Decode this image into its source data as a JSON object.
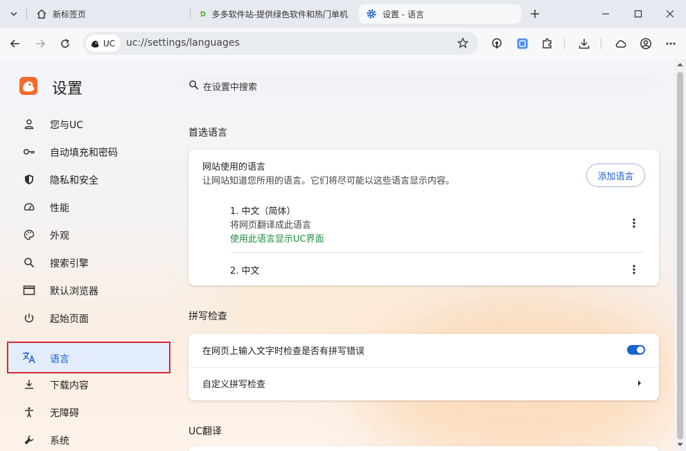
{
  "tabs": [
    {
      "label": "新标签页"
    },
    {
      "label": "多多软件站-提供绿色软件和热门单机"
    },
    {
      "label": "设置 - 语言"
    }
  ],
  "omnibox": {
    "chip_label": "UC",
    "url": "uc://settings/languages"
  },
  "sidebar": {
    "title": "设置",
    "items": [
      {
        "label": "您与UC",
        "icon": "person-icon"
      },
      {
        "label": "自动填充和密码",
        "icon": "key-icon"
      },
      {
        "label": "隐私和安全",
        "icon": "shield-icon"
      },
      {
        "label": "性能",
        "icon": "speedometer-icon"
      },
      {
        "label": "外观",
        "icon": "palette-icon"
      },
      {
        "label": "搜索引擎",
        "icon": "search-icon"
      },
      {
        "label": "默认浏览器",
        "icon": "browser-window-icon"
      },
      {
        "label": "起始页面",
        "icon": "power-icon"
      },
      {
        "label": "语言",
        "icon": "translate-icon"
      },
      {
        "label": "下载内容",
        "icon": "download-icon"
      },
      {
        "label": "无障碍",
        "icon": "accessibility-icon"
      },
      {
        "label": "系统",
        "icon": "wrench-icon"
      }
    ]
  },
  "search": {
    "placeholder": "在设置中搜索"
  },
  "preferred": {
    "section_title": "首选语言",
    "card_title": "网站使用的语言",
    "card_desc": "让网站知道您所用的语言。它们将尽可能以这些语言显示内容。",
    "add_button": "添加语言",
    "languages": [
      {
        "name": "1. 中文（简体）",
        "line2": "将网页翻译成此语言",
        "line3": "使用此语言显示UC界面"
      },
      {
        "name": "2. 中文"
      }
    ]
  },
  "spell": {
    "section_title": "拼写检查",
    "toggle_label": "在网页上输入文字时检查是否有拼写错误",
    "toggle_on": true,
    "custom_label": "自定义拼写检查"
  },
  "translate": {
    "section_title": "UC翻译"
  },
  "colors": {
    "accent": "#1a62d1",
    "highlight_border": "#d8282f",
    "green": "#1e8e3e",
    "logo": "#f46a2a"
  }
}
